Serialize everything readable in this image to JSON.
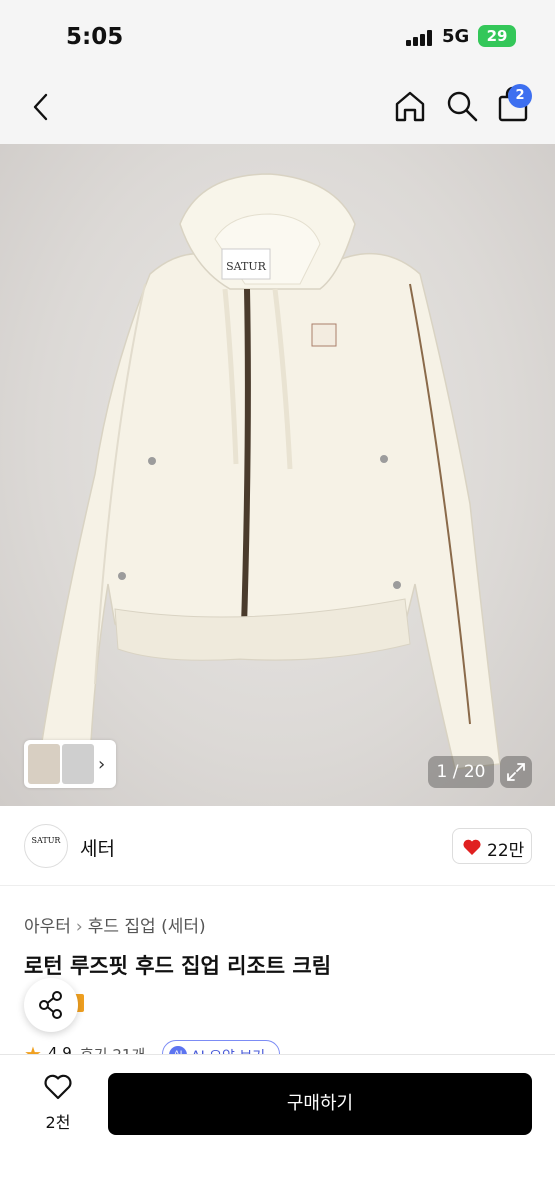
{
  "status_bar": {
    "time": "5:05",
    "network": "5G",
    "battery": "29"
  },
  "nav": {
    "cart_count": "2"
  },
  "gallery": {
    "counter": "1 / 20"
  },
  "brand": {
    "logo_text": "SATUR",
    "name": "세터",
    "likes": "22만"
  },
  "product": {
    "breadcrumb": [
      "아우터",
      "후드 집업 (세터)"
    ],
    "title": "로턴 루즈핏 후드 집업 리조트 크림",
    "rating": "4.9",
    "reviews": "후기 21개",
    "ai_summary_label": "AI 요약 보기",
    "ai_badge": "AI"
  },
  "bottom": {
    "wish_count": "2천",
    "buy_label": "구매하기"
  },
  "colors": {
    "accent_blue": "#3d6ff0",
    "heart_red": "#e02020",
    "battery_green": "#34c759",
    "star": "#f0a020"
  }
}
